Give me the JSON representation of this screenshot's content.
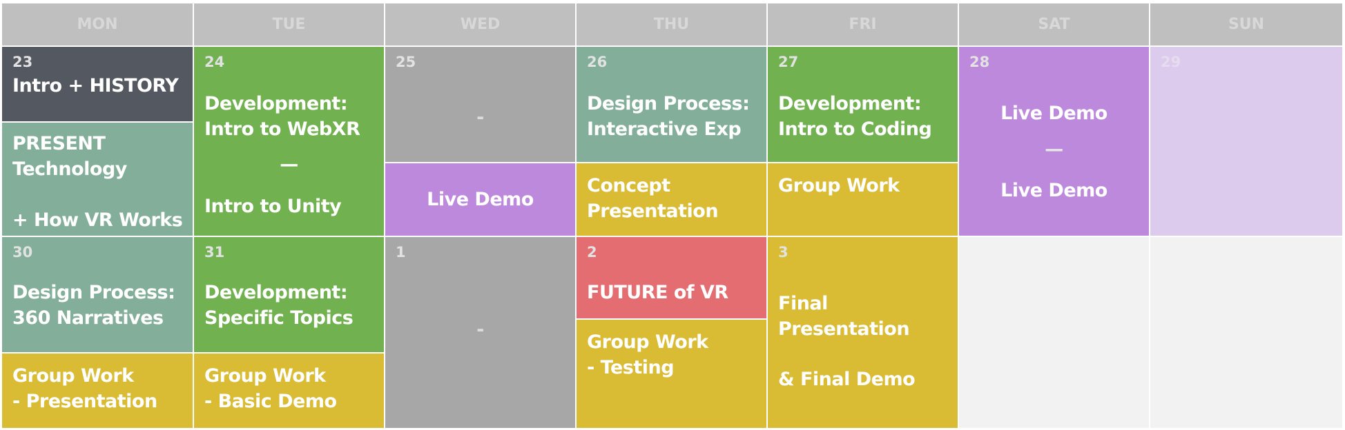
{
  "calendar": {
    "headers": [
      "MON",
      "TUE",
      "WED",
      "THU",
      "FRI",
      "SAT",
      "SUN"
    ],
    "colors": {
      "header_bg": "#bfbfbf",
      "dark": "#545860",
      "teal": "#83af9a",
      "green": "#72b14f",
      "gray": "#a6a7a6",
      "purple": "#bc89dd",
      "light_purple": "#dccbec",
      "yellow": "#d9bc34",
      "red": "#e36d71",
      "empty": "#f2f2f2"
    },
    "week1": {
      "mon": {
        "day": "23",
        "top": "Intro + HISTORY",
        "bottom": "PRESENT\nTechnology\n\n+ How VR Works"
      },
      "tue": {
        "day": "24",
        "line1": "Development:\nIntro to WebXR",
        "dash": "—",
        "line2": "Intro to Unity"
      },
      "wed": {
        "day": "25",
        "top": "-",
        "bottom": "Live Demo"
      },
      "thu": {
        "day": "26",
        "top": "Design Process:\nInteractive Exp",
        "bottom": "Concept\nPresentation"
      },
      "fri": {
        "day": "27",
        "top": "Development:\nIntro to Coding",
        "bottom": "Group Work"
      },
      "sat": {
        "day": "28",
        "line1": "Live Demo",
        "dash": "—",
        "line2": "Live Demo"
      },
      "sun": {
        "day": "29"
      }
    },
    "week2": {
      "mon": {
        "day": "30",
        "top": "Design Process:\n360 Narratives",
        "bottom": "Group Work\n- Presentation"
      },
      "tue": {
        "day": "31",
        "top": "Development:\nSpecific Topics",
        "bottom": "Group Work\n- Basic Demo"
      },
      "wed": {
        "day": "1",
        "center": "-"
      },
      "thu": {
        "day": "2",
        "top": "FUTURE of VR",
        "bottom": "Group Work\n- Testing"
      },
      "fri": {
        "day": "3",
        "line1": "Final\nPresentation",
        "line2": "& Final Demo"
      }
    }
  }
}
